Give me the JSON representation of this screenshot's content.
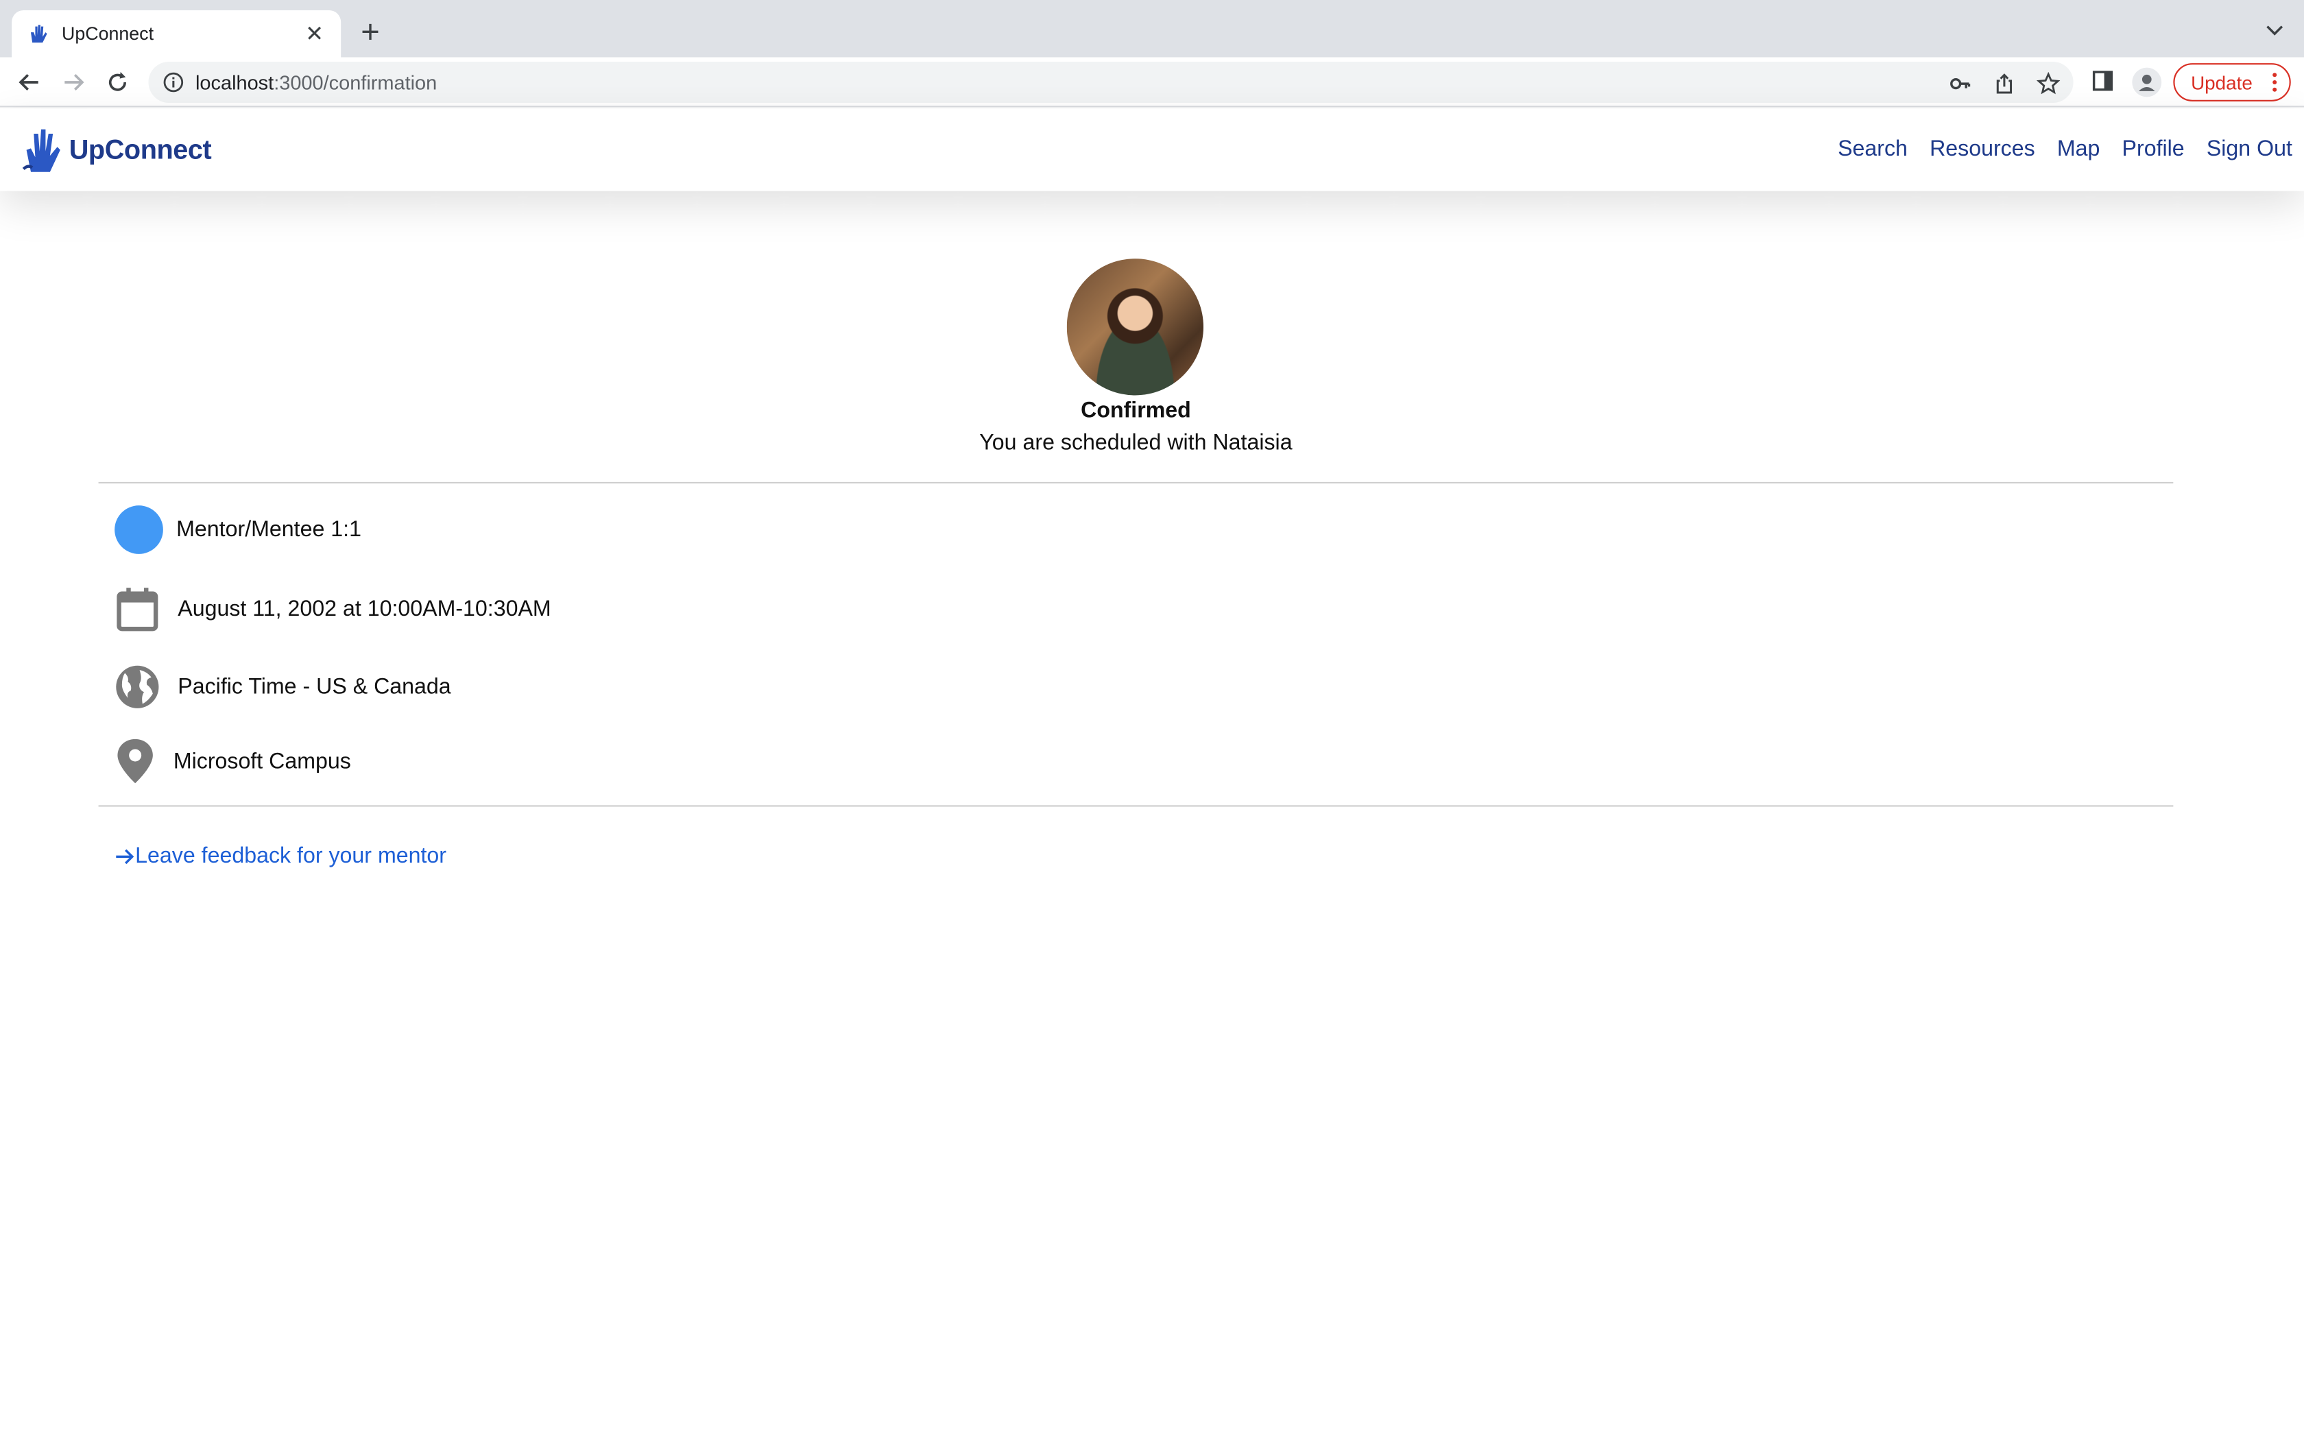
{
  "browser": {
    "tab_title": "UpConnect",
    "url_host": "localhost",
    "url_path": ":3000/confirmation",
    "update_label": "Update"
  },
  "header": {
    "brand": "UpConnect",
    "nav": [
      "Search",
      "Resources",
      "Map",
      "Profile",
      "Sign Out"
    ]
  },
  "confirmation": {
    "status": "Confirmed",
    "message": "You are scheduled with Nataisia",
    "event_type": "Mentor/Mentee 1:1",
    "datetime": "August 11, 2002 at 10:00AM-10:30AM",
    "timezone": "Pacific Time - US & Canada",
    "location": "Microsoft Campus",
    "feedback_link": "Leave feedback for your mentor"
  },
  "colors": {
    "brand": "#1e3a8a",
    "event_dot": "#4299f5",
    "link": "#1d5fd6",
    "update": "#d93025"
  }
}
